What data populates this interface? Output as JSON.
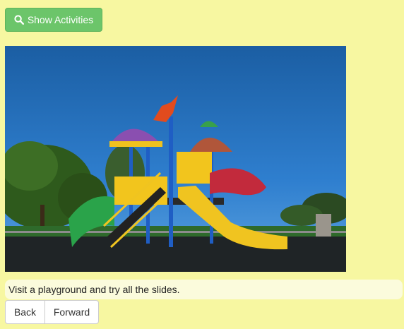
{
  "toolbar": {
    "show_activities_label": "Show Activities",
    "icon": "search-icon",
    "accent_color": "#6cc56a"
  },
  "activity": {
    "image_subject": "playground",
    "text": "Visit a playground and try all the slides."
  },
  "navigation": {
    "back_label": "Back",
    "forward_label": "Forward"
  }
}
